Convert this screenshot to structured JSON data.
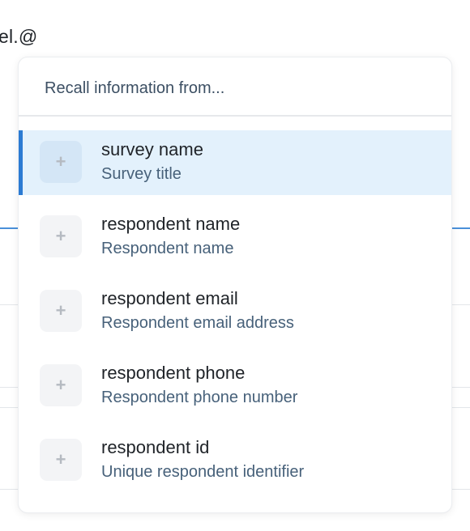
{
  "editor": {
    "text": "el.@"
  },
  "popup": {
    "header": "Recall information from...",
    "options": [
      {
        "icon": "plus-icon",
        "title": "survey name",
        "subtitle": "Survey title",
        "selected": true
      },
      {
        "icon": "plus-icon",
        "title": "respondent name",
        "subtitle": "Respondent name",
        "selected": false
      },
      {
        "icon": "plus-icon",
        "title": "respondent email",
        "subtitle": "Respondent email address",
        "selected": false
      },
      {
        "icon": "plus-icon",
        "title": "respondent phone",
        "subtitle": "Respondent phone number",
        "selected": false
      },
      {
        "icon": "plus-icon",
        "title": "respondent id",
        "subtitle": "Unique respondent identifier",
        "selected": false
      }
    ]
  },
  "colors": {
    "accent": "#2b7bd3",
    "selected_bg": "#e3f1fc"
  }
}
